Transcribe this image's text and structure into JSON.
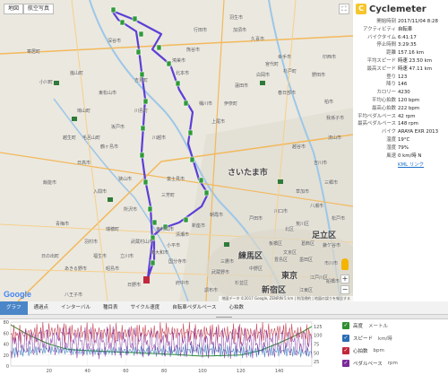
{
  "map": {
    "tabs": [
      "地図",
      "航空写真"
    ],
    "fullscreen_glyph": "⛶",
    "zoom_in": "+",
    "zoom_out": "−",
    "google_logo": "Google",
    "attribution": "地図データ ©2017 Google, ZENRIN 5 km | 利用規約 | 地図の誤りを報告する",
    "cities": {
      "saitama": "さいたま市",
      "nerima": "練馬区",
      "tokyo": "東京",
      "shinjuku": "新宿区",
      "adachi": "足立区",
      "kawagoe": "川越市",
      "hachioji": "八王子市",
      "tokorozawa": "所沢市",
      "kumagaya": "熊谷市",
      "higashimatsuyama": "東松山市",
      "sakado": "坂戸市",
      "ageo": "上尾市",
      "fujimi": "富士見市",
      "iruma": "入間市",
      "sayama": "狭山市",
      "tachikawa": "立川市",
      "koshigaya": "越谷市",
      "kasukabe": "春日部市",
      "kuki": "久喜市",
      "kitamoto": "北本市",
      "konosu": "鴻巣市",
      "okegawa": "桶川市",
      "ome": "青梅市",
      "hanno": "飯能市",
      "kodaira": "小平市",
      "musashino": "武蔵野市",
      "chofu": "調布市",
      "toshima": "豊島区",
      "itabashi": "板橋区",
      "kawaguchi": "川口市",
      "toda": "戸田市",
      "asaka": "朝霞市",
      "niiza": "新座市",
      "kiyose": "清瀬市",
      "higashimurayama": "東村山市",
      "kawajima": "川島町",
      "yoshimi": "吉見町",
      "ranzan": "嵐山町",
      "ogawa": "小川町",
      "yorii": "寄居町",
      "fukaya": "深谷市",
      "gyoda": "行田市",
      "hanyu": "羽生市",
      "kazo": "加須市",
      "shiraoka": "白岡市",
      "hasuda": "蓮田市",
      "ina": "伊奈町",
      "miyoshi": "三芳町",
      "tsurugashima": "鶴ヶ島市",
      "hidaka": "日高市",
      "moroyama": "毛呂山町",
      "ogose": "越生町",
      "hatoyama": "鳩山町",
      "kawaguchi2": "草加市",
      "yashio": "八潮市",
      "misato": "三郷市",
      "yoshikawa": "吉川市",
      "nagareyama": "流山市",
      "matsudo": "松戸市",
      "kashiwa": "柏市",
      "noda": "野田市",
      "satte": "幸手市",
      "sugito": "杉戸町",
      "miyashiro": "宮代町",
      "inzai": "印西市",
      "abiko": "我孫子市",
      "kamagaya": "鎌ケ谷市",
      "ichikawa": "市川市",
      "funabashi": "船橋市",
      "kitahiroshima": "江戸川区",
      "katsushika": "葛飾区",
      "sumida": "墨田区",
      "koto": "江東区",
      "bunkyo": "文京区",
      "kita": "北区",
      "arakawa": "荒川区",
      "nakano": "中野区",
      "suginami": "杉並区",
      "mitaka": "三鷹市",
      "fuchu": "府中市",
      "kokubunji": "国分寺市",
      "hino": "日野市",
      "akishima": "昭島市",
      "fussa": "福生市",
      "hamura": "羽村市",
      "mizuho": "瑞穂町",
      "musashimurayama": "武蔵村山市",
      "higashiyamato": "東大和市",
      "akiruno": "あきる野市",
      "hinode": "日の出町"
    }
  },
  "info": {
    "app_name": "Cyclemeter",
    "rows": [
      {
        "label": "開始時刻",
        "value": "2017/11/04 8:28"
      },
      {
        "label": "アクティビティ",
        "value": "自転車"
      },
      {
        "label": "バイクタイム",
        "value": "6:41:17"
      },
      {
        "label": "停止時間",
        "value": "3:29:35"
      },
      {
        "label": "距離",
        "value": "157.16 km"
      },
      {
        "label": "平均スピード",
        "value": "時速 23.50 km"
      },
      {
        "label": "最高スピード",
        "value": "時速 47.11 km"
      },
      {
        "label": "登り",
        "value": "123"
      },
      {
        "label": "降り",
        "value": "146"
      },
      {
        "label": "カロリー",
        "value": "4230"
      },
      {
        "label": "平均心拍数",
        "value": "120 bpm"
      },
      {
        "label": "最高心拍数",
        "value": "222 bpm"
      },
      {
        "label": "平均ペダルペース",
        "value": "42 rpm"
      },
      {
        "label": "最高ペダルペース",
        "value": "148 rpm"
      },
      {
        "label": "バイク",
        "value": "ARAYA EXR 2013"
      },
      {
        "label": "温度",
        "value": "19°C"
      },
      {
        "label": "湿度",
        "value": "79%"
      },
      {
        "label": "風速",
        "value": "0 km/時 N"
      }
    ],
    "kml_link": "KML リンク"
  },
  "tabs": [
    {
      "label": "グラフ",
      "active": true
    },
    {
      "label": "通過点",
      "active": false
    },
    {
      "label": "インターバル",
      "active": false
    },
    {
      "label": "種目表",
      "active": false
    },
    {
      "label": "サイクル速度",
      "active": false
    },
    {
      "label": "自転車ペダルペース",
      "active": false
    },
    {
      "label": "心拍数",
      "active": false
    }
  ],
  "legend": [
    {
      "label": "高度",
      "unit": "メートル",
      "color": "#2f8f2f"
    },
    {
      "label": "スピード",
      "unit": "km/時",
      "color": "#2a6db5"
    },
    {
      "label": "心拍数",
      "unit": "bpm",
      "color": "#c0283c"
    },
    {
      "label": "ペダルペース",
      "unit": "rpm",
      "color": "#7a2a9a"
    }
  ],
  "chart_data": {
    "type": "line",
    "x_ticks": [
      20,
      40,
      60,
      80,
      100,
      120,
      140
    ],
    "xlim": [
      0,
      157
    ],
    "left_axis_ticks": [
      0,
      20,
      40,
      60,
      80
    ],
    "ylim": [
      0,
      80
    ],
    "right_axis_ticks": [
      25,
      50,
      75,
      100,
      125
    ],
    "series": [
      {
        "name": "高度",
        "x": [
          0,
          10,
          20,
          30,
          40,
          60,
          80,
          100,
          120,
          130,
          140,
          150,
          157
        ],
        "y": [
          75,
          55,
          40,
          30,
          28,
          25,
          22,
          18,
          20,
          28,
          42,
          58,
          72
        ]
      },
      {
        "name": "スピード",
        "x": [
          0,
          20,
          40,
          60,
          80,
          100,
          120,
          140,
          157
        ],
        "y": [
          25,
          30,
          26,
          28,
          27,
          30,
          26,
          28,
          24
        ]
      },
      {
        "name": "心拍数",
        "x": [
          0,
          20,
          40,
          60,
          80,
          100,
          120,
          140,
          157
        ],
        "y": [
          110,
          125,
          120,
          118,
          122,
          120,
          118,
          124,
          115
        ]
      },
      {
        "name": "ペダルペース",
        "x": [
          0,
          20,
          40,
          60,
          80,
          100,
          120,
          140,
          157
        ],
        "y": [
          40,
          45,
          42,
          44,
          40,
          42,
          43,
          41,
          40
        ]
      }
    ]
  }
}
